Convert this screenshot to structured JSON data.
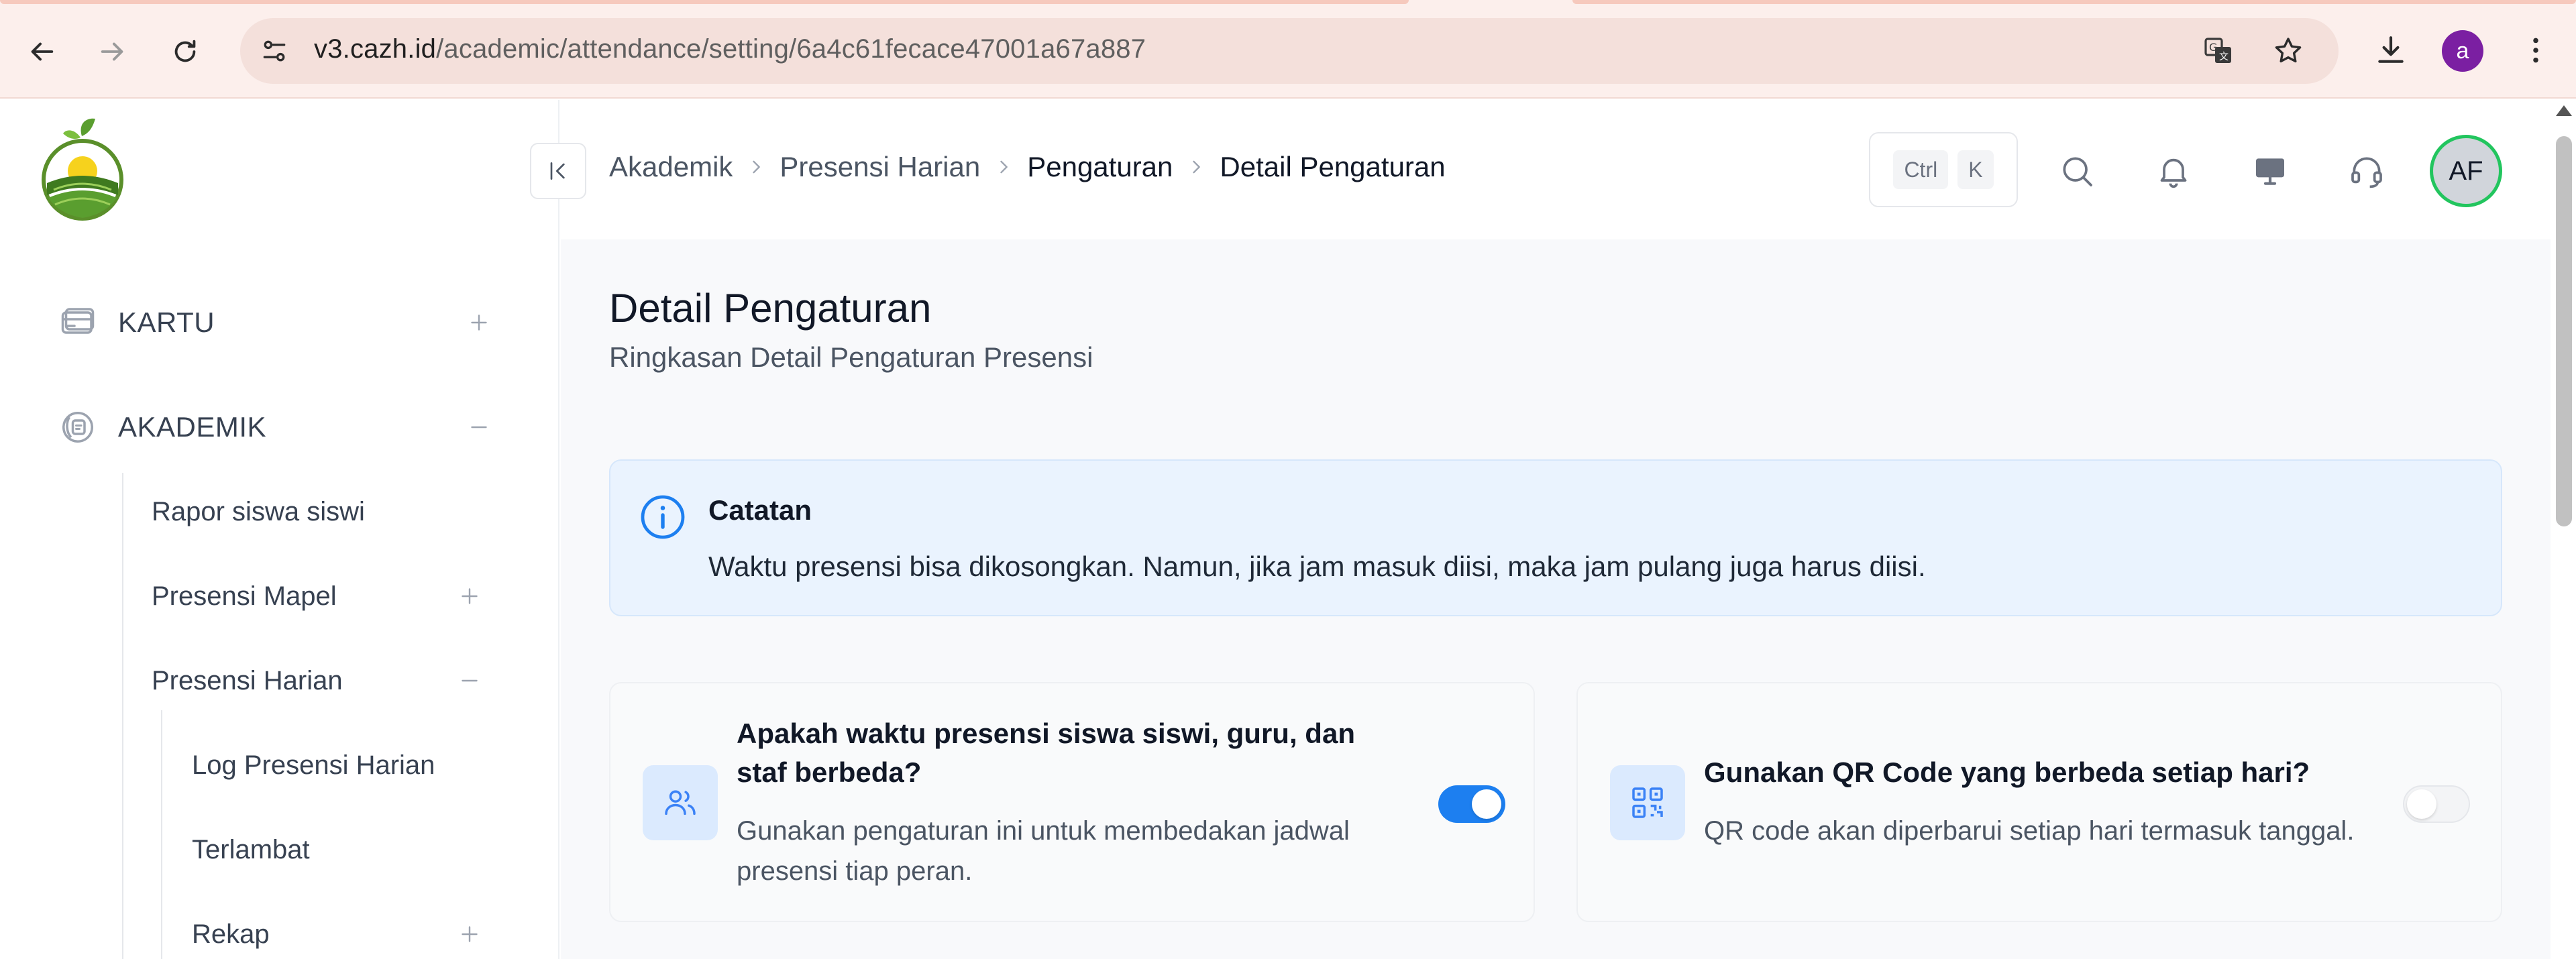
{
  "browser": {
    "url_host": "v3.cazh.id",
    "url_path": "/academic/attendance/setting/6a4c61fecace47001a67a887",
    "profile_initial": "a"
  },
  "sidebar": {
    "items": [
      {
        "label": "KARTU",
        "icon": "card-icon",
        "expanded": false
      },
      {
        "label": "AKADEMIK",
        "icon": "academic-icon",
        "expanded": true
      }
    ],
    "sub_items": [
      {
        "label": "Rapor siswa siswi"
      },
      {
        "label": "Presensi Mapel",
        "toggle": "plus"
      },
      {
        "label": "Presensi Harian",
        "toggle": "minus"
      }
    ],
    "sub_sub_items": [
      {
        "label": "Log Presensi Harian"
      },
      {
        "label": "Terlambat"
      },
      {
        "label": "Rekap",
        "toggle": "plus"
      }
    ]
  },
  "header": {
    "breadcrumb": [
      "Akademik",
      "Presensi Harian",
      "Pengaturan",
      "Detail Pengaturan"
    ],
    "shortcut_keys": [
      "Ctrl",
      "K"
    ],
    "avatar_initials": "AF"
  },
  "main": {
    "title": "Detail Pengaturan",
    "subtitle": "Ringkasan Detail Pengaturan Presensi",
    "note": {
      "title": "Catatan",
      "text": "Waktu presensi bisa dikosongkan. Namun, jika jam masuk diisi, maka jam pulang juga harus diisi."
    },
    "cards": [
      {
        "title_line1": "Apakah waktu presensi siswa siswi, guru, dan",
        "title_line2": "staf berbeda?",
        "desc_line1": "Gunakan pengaturan ini untuk membedakan jadwal",
        "desc_line2": "presensi tiap peran.",
        "enabled": true
      },
      {
        "title": "Gunakan QR Code yang berbeda setiap hari?",
        "desc": "QR code akan diperbarui setiap hari termasuk tanggal.",
        "enabled": false
      }
    ]
  },
  "colors": {
    "accent": "#1d7ff0",
    "avatar_ring": "#22c55e",
    "note_bg": "#eaf3fe",
    "chrome_bg": "#fcefec"
  }
}
